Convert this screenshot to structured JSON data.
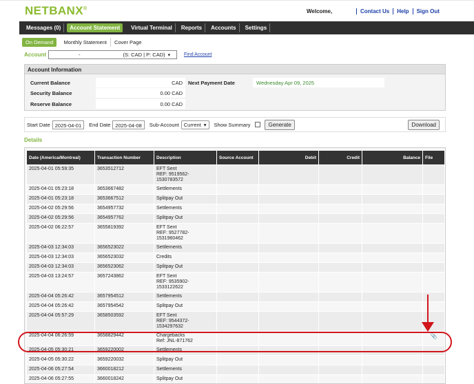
{
  "brand": {
    "logo": "NETBANX"
  },
  "header": {
    "welcome": "Welcome,",
    "links": [
      "Contact Us",
      "Help",
      "Sign Out"
    ]
  },
  "nav": {
    "items": [
      "Messages (0)",
      "Account Statement",
      "Virtual Terminal",
      "Reports",
      "Accounts",
      "Settings"
    ],
    "active": "Account Statement"
  },
  "subnav": {
    "items": [
      "On Demand",
      "Monthly Statement",
      "Cover Page"
    ],
    "active": "On Demand"
  },
  "account": {
    "label": "Account",
    "select_dash": "-",
    "select_currency": "(S: CAD | P: CAD)",
    "find_link": "Find Account"
  },
  "info": {
    "title": "Account Information",
    "rows": [
      {
        "label": "Current Balance",
        "value": "CAD"
      },
      {
        "label": "Security Balance",
        "value": "0.00 CAD"
      },
      {
        "label": "Reserve Balance",
        "value": "0.00 CAD"
      }
    ],
    "next_payment_label": "Next Payment Date",
    "next_payment_value": "Wednesday Apr 09, 2025"
  },
  "filters": {
    "start_label": "Start Date",
    "start_value": "2025-04-01",
    "end_label": "End Date",
    "end_value": "2025-04-08",
    "subaccount_label": "Sub-Account",
    "subaccount_value": "Current",
    "summary_label": "Show Summary",
    "generate_label": "Generate",
    "export_label": "Download"
  },
  "details_title": "Details",
  "table": {
    "headers": [
      "Date (America/Montreal)",
      "Transaction Number",
      "Description",
      "Source Account",
      "Debit",
      "Credit",
      "Balance",
      "File"
    ],
    "rows": [
      {
        "date": "2025-04-01 05:59:35",
        "txn": "3653512712",
        "desc": [
          "EFT Sent",
          "REF: 9519562-",
          "1530783572"
        ]
      },
      {
        "date": "2025-04-01 05:23:18",
        "txn": "3653667482",
        "desc": [
          "Settlements"
        ]
      },
      {
        "date": "2025-04-01 05:23:18",
        "txn": "3653667512",
        "desc": [
          "Splitpay Out"
        ]
      },
      {
        "date": "2025-04-02 05:29:56",
        "txn": "3654957732",
        "desc": [
          "Settlements"
        ]
      },
      {
        "date": "2025-04-02 05:29:56",
        "txn": "3654957762",
        "desc": [
          "Splitpay Out"
        ]
      },
      {
        "date": "2025-04-02 06:22:57",
        "txn": "3655819392",
        "desc": [
          "EFT Sent",
          "REF: 9527782-",
          "1531960462"
        ]
      },
      {
        "date": "2025-04-03 12:34:03",
        "txn": "3656523022",
        "desc": [
          "Settlements"
        ]
      },
      {
        "date": "2025-04-03 12:34:03",
        "txn": "3656523032",
        "desc": [
          "Credits"
        ]
      },
      {
        "date": "2025-04-03 12:34:03",
        "txn": "3656523062",
        "desc": [
          "Splitpay Out"
        ]
      },
      {
        "date": "2025-04-03 13:24:57",
        "txn": "3657243862",
        "desc": [
          "EFT Sent",
          "REF: 9535902-",
          "1533122622"
        ]
      },
      {
        "date": "2025-04-04 05:26:42",
        "txn": "3657954512",
        "desc": [
          "Settlements"
        ]
      },
      {
        "date": "2025-04-04 05:26:42",
        "txn": "3657954542",
        "desc": [
          "Splitpay Out"
        ]
      },
      {
        "date": "2025-04-04 05:57:29",
        "txn": "3658503592",
        "desc": [
          "EFT Sent",
          "REF: 9544372-",
          "1534297632"
        ]
      },
      {
        "date": "2025-04-04 06:26:59",
        "txn": "3658829442",
        "desc": [
          "Chargebacks",
          "Ref: JNL-871762"
        ],
        "file": true
      },
      {
        "date": "2025-04-05 05:30:21",
        "txn": "3659220002",
        "desc": [
          "Settlements"
        ]
      },
      {
        "date": "2025-04-05 05:30:22",
        "txn": "3659220032",
        "desc": [
          "Splitpay Out"
        ]
      },
      {
        "date": "2025-04-06 05:27:54",
        "txn": "3660018212",
        "desc": [
          "Settlements"
        ]
      },
      {
        "date": "2025-04-06 05:27:55",
        "txn": "3660018242",
        "desc": [
          "Splitpay Out"
        ]
      }
    ]
  },
  "colors": {
    "brand_green": "#82b441",
    "nav_bg": "#2f2f2f",
    "link_blue": "#1d3ea8",
    "highlight_red": "#d0151b"
  },
  "icons": {
    "file": "paperclip-icon"
  }
}
